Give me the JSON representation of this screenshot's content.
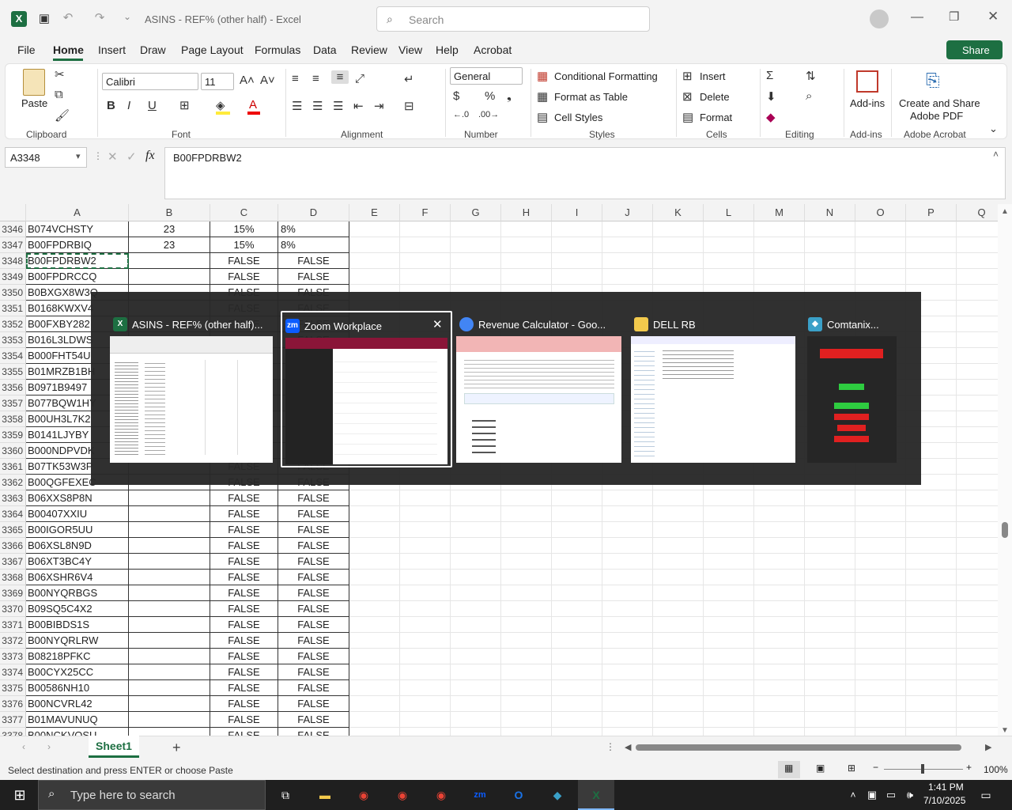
{
  "titlebar": {
    "doc_title": "ASINS - REF% (other half)  -  Excel",
    "search_placeholder": "Search"
  },
  "ribbon": {
    "tabs": [
      "File",
      "Home",
      "Insert",
      "Draw",
      "Page Layout",
      "Formulas",
      "Data",
      "Review",
      "View",
      "Help",
      "Acrobat"
    ],
    "share_label": "Share",
    "paste_label": "Paste",
    "font_name": "Calibri",
    "font_size": "11",
    "number_format": "General",
    "conditional_formatting": "Conditional Formatting",
    "format_as_table": "Format as Table",
    "cell_styles": "Cell Styles",
    "insert_label": "Insert",
    "delete_label": "Delete",
    "format_label": "Format",
    "addins_label": "Add-ins",
    "create_share_pdf_line1": "Create and Share",
    "create_share_pdf_line2": "Adobe PDF",
    "groups": {
      "clipboard": "Clipboard",
      "font": "Font",
      "alignment": "Alignment",
      "number": "Number",
      "styles": "Styles",
      "cells": "Cells",
      "editing": "Editing",
      "addins": "Add-ins",
      "acrobat": "Adobe Acrobat"
    }
  },
  "formula_bar": {
    "name_box": "A3348",
    "content": "B00FPDRBW2"
  },
  "columns": [
    "A",
    "B",
    "C",
    "D",
    "E",
    "F",
    "G",
    "H",
    "I",
    "J",
    "K",
    "L",
    "M",
    "N",
    "O",
    "P",
    "Q"
  ],
  "rows": [
    {
      "num": "3346",
      "a": "B074VCHSTY",
      "b": "23",
      "c": "15%",
      "d": "8%"
    },
    {
      "num": "3347",
      "a": "B00FPDRBIQ",
      "b": "23",
      "c": "15%",
      "d": "8%"
    },
    {
      "num": "3348",
      "a": "B00FPDRBW2",
      "b": "",
      "c": "FALSE",
      "d": "FALSE"
    },
    {
      "num": "3349",
      "a": "B00FPDRCCQ",
      "b": "",
      "c": "FALSE",
      "d": "FALSE"
    },
    {
      "num": "3350",
      "a": "B0BXGX8W3Q",
      "b": "",
      "c": "FALSE",
      "d": "FALSE"
    },
    {
      "num": "3351",
      "a": "B0168KWXV4",
      "b": "",
      "c": "FALSE",
      "d": "FALSE"
    },
    {
      "num": "3352",
      "a": "B00FXBY282",
      "b": "",
      "c": "FALSE",
      "d": "FALSE"
    },
    {
      "num": "3353",
      "a": "B016L3LDWS",
      "b": "",
      "c": "FALSE",
      "d": "FALSE"
    },
    {
      "num": "3354",
      "a": "B000FHT54U",
      "b": "",
      "c": "FALSE",
      "d": "FALSE"
    },
    {
      "num": "3355",
      "a": "B01MRZB1BH",
      "b": "",
      "c": "FALSE",
      "d": "FALSE"
    },
    {
      "num": "3356",
      "a": "B0971B9497",
      "b": "",
      "c": "FALSE",
      "d": "FALSE"
    },
    {
      "num": "3357",
      "a": "B077BQW1HY",
      "b": "",
      "c": "FALSE",
      "d": "FALSE"
    },
    {
      "num": "3358",
      "a": "B00UH3L7K2",
      "b": "",
      "c": "FALSE",
      "d": "FALSE"
    },
    {
      "num": "3359",
      "a": "B0141LJYBY",
      "b": "",
      "c": "FALSE",
      "d": "FALSE"
    },
    {
      "num": "3360",
      "a": "B000NDPVDK",
      "b": "",
      "c": "FALSE",
      "d": "FALSE"
    },
    {
      "num": "3361",
      "a": "B07TK53W3P",
      "b": "",
      "c": "FALSE",
      "d": "FALSE"
    },
    {
      "num": "3362",
      "a": "B00QGFEXEC",
      "b": "",
      "c": "FALSE",
      "d": "FALSE"
    },
    {
      "num": "3363",
      "a": "B06XXS8P8N",
      "b": "",
      "c": "FALSE",
      "d": "FALSE"
    },
    {
      "num": "3364",
      "a": "B00407XXIU",
      "b": "",
      "c": "FALSE",
      "d": "FALSE"
    },
    {
      "num": "3365",
      "a": "B00IGOR5UU",
      "b": "",
      "c": "FALSE",
      "d": "FALSE"
    },
    {
      "num": "3366",
      "a": "B06XSL8N9D",
      "b": "",
      "c": "FALSE",
      "d": "FALSE"
    },
    {
      "num": "3367",
      "a": "B06XT3BC4Y",
      "b": "",
      "c": "FALSE",
      "d": "FALSE"
    },
    {
      "num": "3368",
      "a": "B06XSHR6V4",
      "b": "",
      "c": "FALSE",
      "d": "FALSE"
    },
    {
      "num": "3369",
      "a": "B00NYQRBGS",
      "b": "",
      "c": "FALSE",
      "d": "FALSE"
    },
    {
      "num": "3370",
      "a": "B09SQ5C4X2",
      "b": "",
      "c": "FALSE",
      "d": "FALSE"
    },
    {
      "num": "3371",
      "a": "B00BIBDS1S",
      "b": "",
      "c": "FALSE",
      "d": "FALSE"
    },
    {
      "num": "3372",
      "a": "B00NYQRLRW",
      "b": "",
      "c": "FALSE",
      "d": "FALSE"
    },
    {
      "num": "3373",
      "a": "B08218PFKC",
      "b": "",
      "c": "FALSE",
      "d": "FALSE"
    },
    {
      "num": "3374",
      "a": "B00CYX25CC",
      "b": "",
      "c": "FALSE",
      "d": "FALSE"
    },
    {
      "num": "3375",
      "a": "B00586NH10",
      "b": "",
      "c": "FALSE",
      "d": "FALSE"
    },
    {
      "num": "3376",
      "a": "B00NCVRL42",
      "b": "",
      "c": "FALSE",
      "d": "FALSE"
    },
    {
      "num": "3377",
      "a": "B01MAVUNUQ",
      "b": "",
      "c": "FALSE",
      "d": "FALSE"
    },
    {
      "num": "3378",
      "a": "B00NCKVOSU",
      "b": "",
      "c": "FALSE",
      "d": "FALSE"
    }
  ],
  "sheet_tabs": [
    "Sheet1"
  ],
  "status": {
    "message": "Select destination and press ENTER or choose Paste",
    "zoom": "100%"
  },
  "alt_tab": {
    "windows": [
      {
        "title": "ASINS - REF% (other half)...",
        "app": "excel",
        "color": "#1d6f42"
      },
      {
        "title": "Zoom Workplace",
        "app": "zoom",
        "color": "#0b5cff",
        "selected": true
      },
      {
        "title": "Revenue Calculator - Goo...",
        "app": "chrome",
        "color": "#4285f4"
      },
      {
        "title": "DELL RB",
        "app": "explorer",
        "color": "#f2c94c"
      },
      {
        "title": "Comtanix...",
        "app": "comtanix",
        "color": "#3aa0c8"
      }
    ]
  },
  "taskbar": {
    "search_placeholder": "Type here to search",
    "time": "1:41 PM",
    "date": "7/10/2025"
  }
}
